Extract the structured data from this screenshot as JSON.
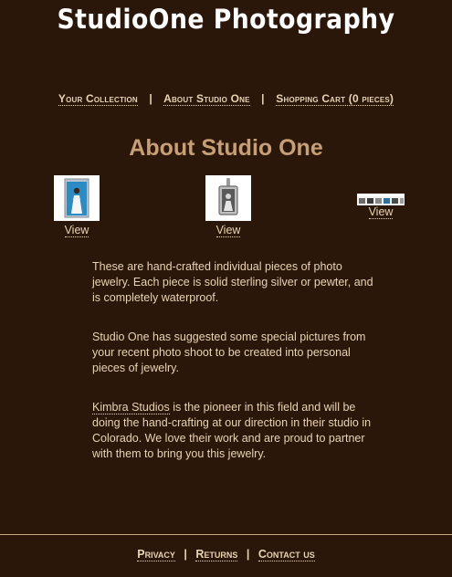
{
  "site": {
    "title": "StudioOne Photography"
  },
  "top_nav": {
    "items": [
      {
        "label": "Your Collection"
      },
      {
        "label": "About Studio One"
      },
      {
        "label": "Shopping Cart (0 pieces)"
      }
    ],
    "separator": "|"
  },
  "page": {
    "heading": "About Studio One"
  },
  "products": [
    {
      "image": "bride-photo-pendant",
      "view_label": "View"
    },
    {
      "image": "silver-pendant-charm",
      "view_label": "View"
    },
    {
      "image": "photo-bracelet-strip",
      "view_label": "View"
    }
  ],
  "content": {
    "paragraph1": "These are hand-crafted individual pieces of photo jewelry. Each piece is solid sterling silver or pewter, and is completely waterproof.",
    "paragraph2": "Studio One has suggested some special pictures from your recent photo shoot to be created into personal pieces of jewelry.",
    "paragraph3_link": "Kimbra Studios",
    "paragraph3_rest": " is the pioneer in this field and will be doing the hand-crafting at our direction in their studio in Colorado. We love their work and are proud to partner with them to bring you this jewelry."
  },
  "footer_nav": {
    "items": [
      {
        "label": "Privacy"
      },
      {
        "label": "Returns"
      },
      {
        "label": "Contact us"
      }
    ],
    "separator": "|"
  },
  "colors": {
    "background": "#2a1709",
    "text": "#e8d3b3",
    "heading": "#c79f74",
    "title": "#ffffff"
  }
}
